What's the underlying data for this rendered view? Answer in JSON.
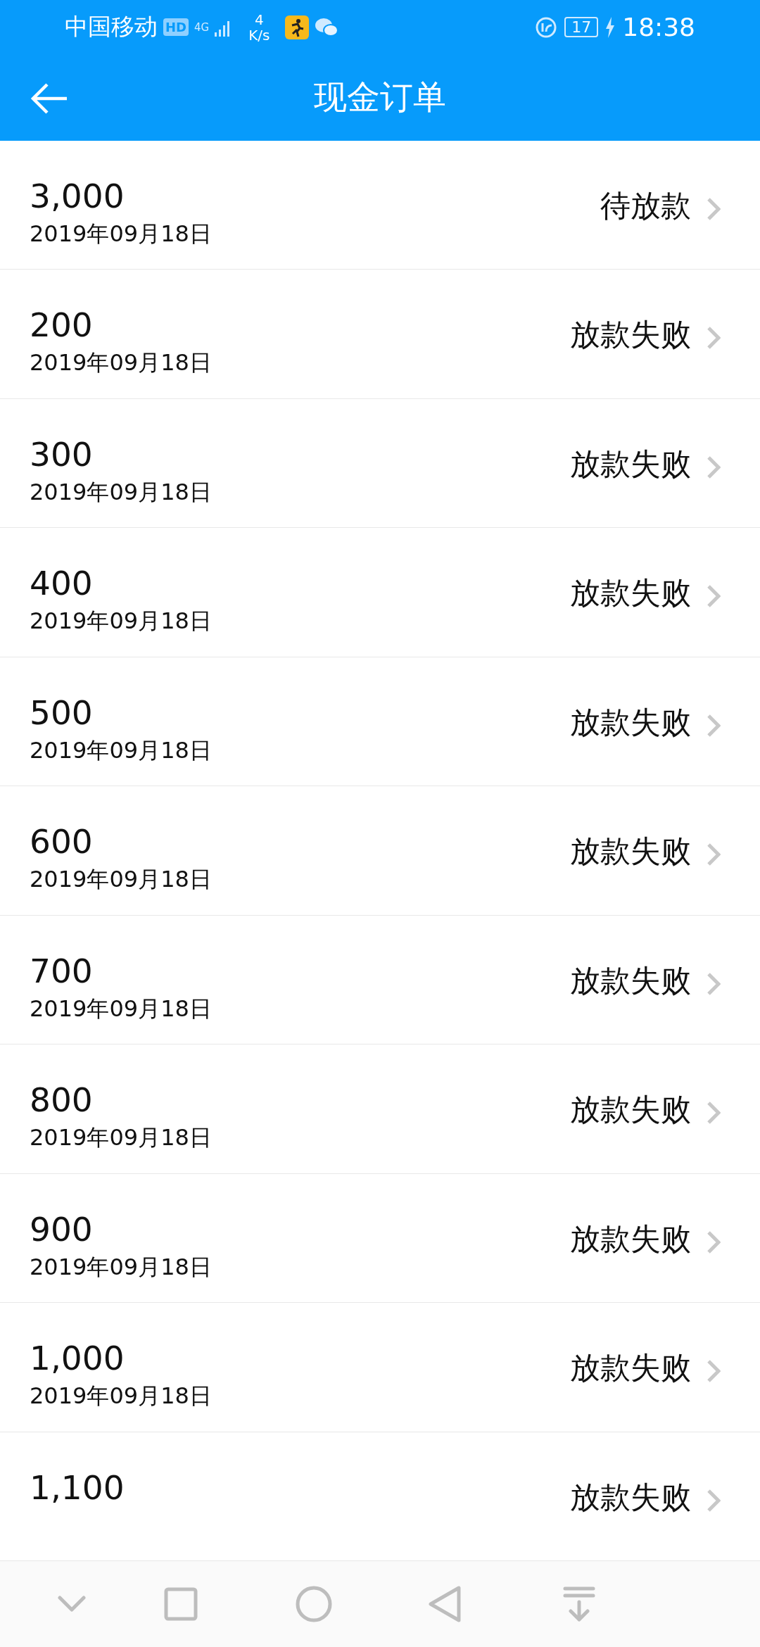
{
  "status_bar": {
    "carrier": "中国移动",
    "hd_badge": "HD",
    "network": "4G",
    "speed_value": "4",
    "speed_unit": "K/s",
    "battery": "17",
    "time": "18:38"
  },
  "header": {
    "title": "现金订单"
  },
  "orders": [
    {
      "amount": "3,000",
      "date": "2019年09月18日",
      "status": "待放款"
    },
    {
      "amount": "200",
      "date": "2019年09月18日",
      "status": "放款失败"
    },
    {
      "amount": "300",
      "date": "2019年09月18日",
      "status": "放款失败"
    },
    {
      "amount": "400",
      "date": "2019年09月18日",
      "status": "放款失败"
    },
    {
      "amount": "500",
      "date": "2019年09月18日",
      "status": "放款失败"
    },
    {
      "amount": "600",
      "date": "2019年09月18日",
      "status": "放款失败"
    },
    {
      "amount": "700",
      "date": "2019年09月18日",
      "status": "放款失败"
    },
    {
      "amount": "800",
      "date": "2019年09月18日",
      "status": "放款失败"
    },
    {
      "amount": "900",
      "date": "2019年09月18日",
      "status": "放款失败"
    },
    {
      "amount": "1,000",
      "date": "2019年09月18日",
      "status": "放款失败"
    },
    {
      "amount": "1,100",
      "status": "放款失败"
    }
  ]
}
